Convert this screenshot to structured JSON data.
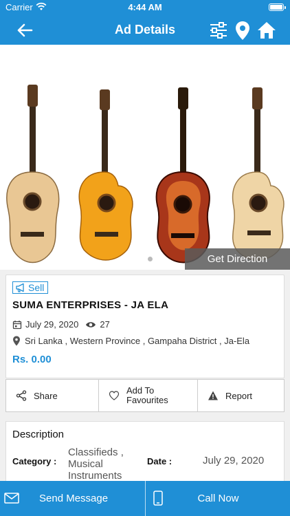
{
  "status": {
    "carrier": "Carrier",
    "time": "4:44 AM"
  },
  "nav": {
    "title": "Ad Details"
  },
  "hero": {
    "direction_label": "Get Direction"
  },
  "ad": {
    "badge": "Sell",
    "company": "SUMA ENTERPRISES - JA ELA",
    "date": "July 29, 2020",
    "views": "27",
    "location": "Sri Lanka , Western Province , Gampaha District , Ja-Ela",
    "price": "Rs. 0.00"
  },
  "actions": {
    "share": "Share",
    "favourite": "Add To Favourites",
    "report": "Report"
  },
  "description": {
    "title": "Description",
    "category_label": "Category :",
    "category_value": "Classifieds , Musical Instruments",
    "date_label": "Date :",
    "date_value": "July 29, 2020"
  },
  "bottom": {
    "send_message": "Send Message",
    "call_now": "Call Now"
  },
  "colors": {
    "primary": "#1f8fd6",
    "price": "#1f8fd6",
    "overlay": "#5a5a5a"
  }
}
